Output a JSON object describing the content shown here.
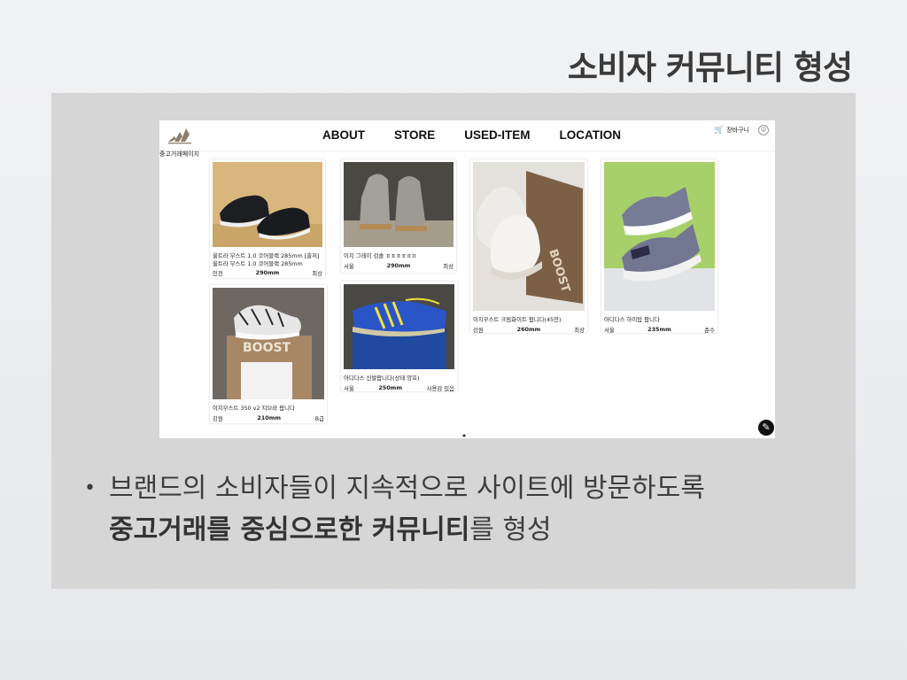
{
  "slide": {
    "title": "소비자 커뮤니티 형성",
    "bullet_dot": "•",
    "bullet_line1": "브랜드의 소비자들이 지속적으로 사이트에 방문하도록",
    "bullet_bold1": "중고거래를 중심으로한 커뮤니티",
    "bullet_rest": "를 형성"
  },
  "site": {
    "nav": [
      "ABOUT",
      "STORE",
      "USED-ITEM",
      "LOCATION"
    ],
    "cart_label": "장바구니",
    "page_label": "중고거래페이지",
    "edit_icon": "pencil-icon"
  },
  "cards": [
    {
      "title": "울트라 부스트 1.0 코어블랙 285mm [출처] 울트라 부스트 1.0 코어블랙 285mm",
      "region": "인천",
      "size": "290mm",
      "condition": "최상"
    },
    {
      "title": "이지 그레이 검솔 ㅍㅍㅍㅍㅍㅍ",
      "region": "서울",
      "size": "290mm",
      "condition": "최상"
    },
    {
      "title": "이지부스트 크림화이트 팝니다(45만)",
      "region": "강원",
      "size": "260mm",
      "condition": "최상"
    },
    {
      "title": "아디다스 하이탑 팝니다",
      "region": "서울",
      "size": "235mm",
      "condition": "준수"
    },
    {
      "title": "이지부스트 350 v2 지브라 팝니다",
      "region": "강원",
      "size": "210mm",
      "condition": "B급"
    },
    {
      "title": "아디다스 신발팝니다(상태 양호)",
      "region": "서울",
      "size": "250mm",
      "condition": "사용감 있음"
    }
  ],
  "colors": {
    "cart_accent": "#e03a26",
    "panel": "#d6d6d6"
  }
}
